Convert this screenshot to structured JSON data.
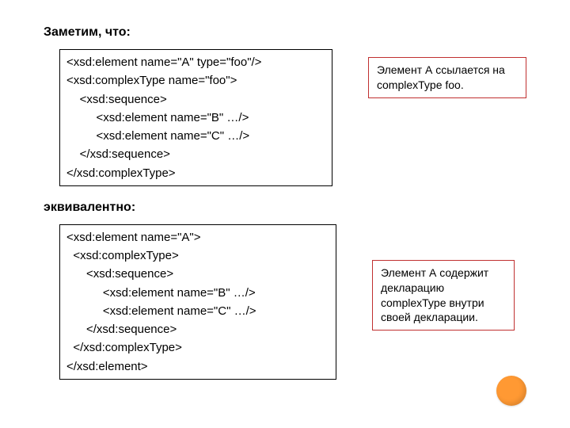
{
  "heading1": "Заметим, что:",
  "heading2": "эквивалентно:",
  "code1": {
    "l1": "<xsd:element name=\"A\" type=\"foo\"/>",
    "l2": "<xsd:complexType name=\"foo\">",
    "l3": "    <xsd:sequence>",
    "l4": "         <xsd:element name=\"B\" …/>",
    "l5": "         <xsd:element name=\"C\" …/>",
    "l6": "    </xsd:sequence>",
    "l7": "</xsd:complexType>"
  },
  "note1": "Элемент А ссылается на complexType foo.",
  "code2": {
    "l1": "<xsd:element name=\"A\">",
    "l2": "  <xsd:complexType>",
    "l3": "      <xsd:sequence>",
    "l4": "           <xsd:element name=\"B\" …/>",
    "l5": "           <xsd:element name=\"C\" …/>",
    "l6": "      </xsd:sequence>",
    "l7": "  </xsd:complexType>",
    "l8": "</xsd:element>"
  },
  "note2": "Элемент А содержит декларацию complexType внутри своей декларации."
}
